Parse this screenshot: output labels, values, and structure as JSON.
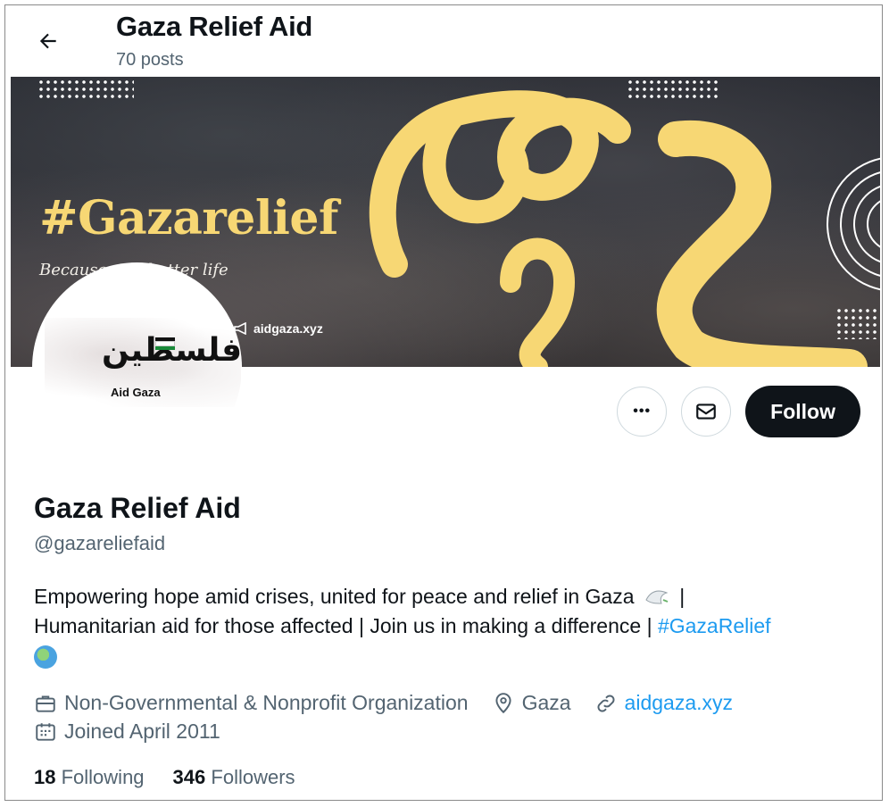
{
  "header": {
    "title": "Gaza Relief Aid",
    "posts": "70 posts"
  },
  "banner": {
    "hashtag": "#Gazarelief",
    "tagline": "Because ... a better life",
    "url": "aidgaza.xyz",
    "accent_color": "#f7d774"
  },
  "avatar": {
    "arabic_text": "فلسطين",
    "caption": "Aid Gaza"
  },
  "actions": {
    "more_label": "•••",
    "follow_label": "Follow"
  },
  "profile": {
    "name": "Gaza Relief Aid",
    "handle": "@gazareliefaid",
    "bio_line1": "Empowering hope amid crises, united for peace and relief in Gaza",
    "bio_sep1": " |",
    "bio_line2": "Humanitarian aid for those affected | Join us in making a difference | ",
    "bio_hashtag": "#GazaRelief",
    "category": "Non-Governmental & Nonprofit Organization",
    "location": "Gaza",
    "website": "aidgaza.xyz",
    "joined": "Joined April 2011",
    "following_count": "18",
    "following_label": "Following",
    "followers_count": "346",
    "followers_label": "Followers"
  },
  "colors": {
    "link": "#1d9bf0",
    "muted": "#536471",
    "text": "#0f1419"
  }
}
